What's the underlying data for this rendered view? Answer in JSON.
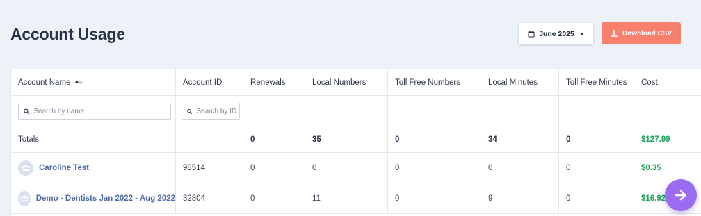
{
  "page": {
    "title": "Account Usage"
  },
  "toolbar": {
    "month_label": "June 2025",
    "download_label": "Download CSV",
    "download_color": "#f8806d"
  },
  "table": {
    "columns": [
      "Account Name",
      "Account ID",
      "Renewals",
      "Local Numbers",
      "Toll Free Numbers",
      "Local Minutes",
      "Toll Free Minutes",
      "Cost"
    ],
    "filters": {
      "name_placeholder": "Search by name",
      "id_placeholder": "Search by ID"
    },
    "totals": {
      "label": "Totals",
      "renewals": "0",
      "local_numbers": "35",
      "toll_free_numbers": "0",
      "local_minutes": "34",
      "toll_free_minutes": "0",
      "cost": "$127.99"
    },
    "rows": [
      {
        "name": "Caroline Test",
        "id": "98514",
        "renewals": "0",
        "local_numbers": "0",
        "toll_free_numbers": "0",
        "local_minutes": "0",
        "toll_free_minutes": "0",
        "cost": "$0.35"
      },
      {
        "name": "Demo - Dentists Jan 2022 - Aug 2022",
        "id": "32804",
        "renewals": "0",
        "local_numbers": "11",
        "toll_free_numbers": "0",
        "local_minutes": "9",
        "toll_free_minutes": "0",
        "cost": "$16.92"
      }
    ]
  },
  "colors": {
    "money": "#1fa25a",
    "link": "#4e6aa8",
    "fab": "#9b6cf2"
  },
  "icons": {
    "month": "calendar-icon",
    "download": "download-icon",
    "fab": "arrow-right-icon",
    "search": "search-icon",
    "avatar": "users-icon",
    "sort": "sort-icon"
  }
}
